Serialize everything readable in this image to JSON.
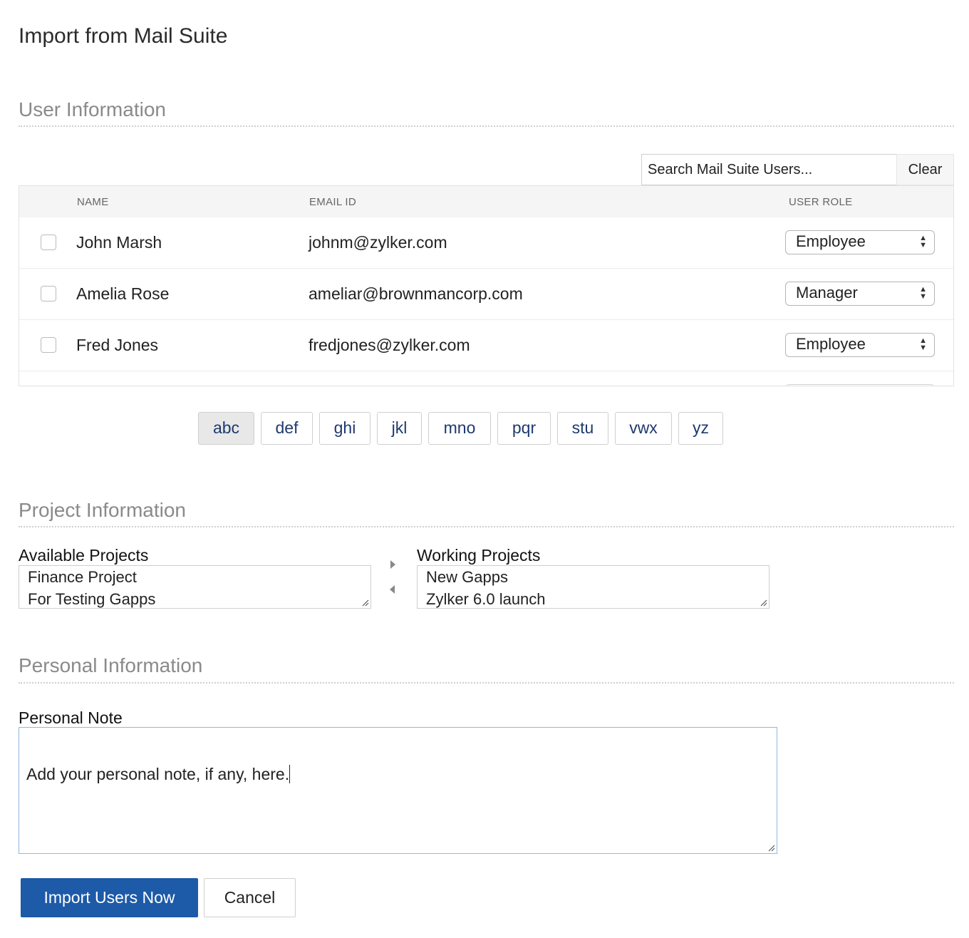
{
  "page": {
    "title": "Import from Mail Suite"
  },
  "user_section": {
    "title": "User Information",
    "search": {
      "placeholder": "Search Mail Suite Users...",
      "clear_label": "Clear"
    },
    "columns": {
      "name": "NAME",
      "email": "EMAIL ID",
      "role": "USER ROLE"
    },
    "rows": [
      {
        "name": "John Marsh",
        "email": "johnm@zylker.com",
        "role": "Employee",
        "checked": false
      },
      {
        "name": "Amelia Rose",
        "email": "ameliar@brownmancorp.com",
        "role": "Manager",
        "checked": false
      },
      {
        "name": "Fred Jones",
        "email": "fredjones@zylker.com",
        "role": "Employee",
        "checked": false
      }
    ],
    "pagination": [
      "abc",
      "def",
      "ghi",
      "jkl",
      "mno",
      "pqr",
      "stu",
      "vwx",
      "yz"
    ],
    "active_page": "abc"
  },
  "project_section": {
    "title": "Project Information",
    "available": {
      "label": "Available Projects",
      "items": [
        "Finance Project",
        "For Testing Gapps"
      ]
    },
    "working": {
      "label": "Working Projects",
      "items": [
        "New Gapps",
        "Zylker 6.0 launch"
      ]
    }
  },
  "personal_section": {
    "title": "Personal Information",
    "note_label": "Personal Note",
    "note_value": "Add your personal note, if any, here."
  },
  "actions": {
    "import_label": "Import Users Now",
    "cancel_label": "Cancel"
  },
  "colors": {
    "primary": "#1d5aa8",
    "section_title": "#8a8a8a",
    "focus_border": "#8fb8e0"
  }
}
